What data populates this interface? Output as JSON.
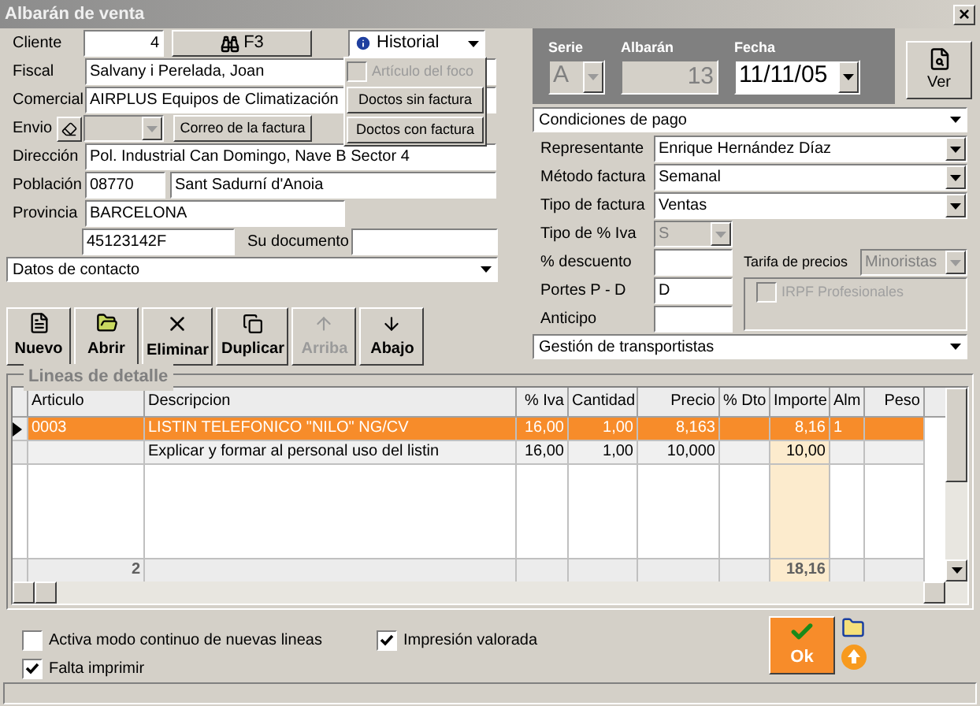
{
  "window": {
    "title": "Albarán de venta",
    "close": "×"
  },
  "cliente": {
    "label": "Cliente",
    "value": "4",
    "search_button": "F3"
  },
  "historial": {
    "label": "Historial",
    "expanded": true,
    "items": [
      {
        "kind": "checkbox",
        "label": "Artículo del foco",
        "disabled": true,
        "checked": false
      },
      {
        "kind": "button",
        "label": "Doctos sin factura"
      },
      {
        "kind": "button",
        "label": "Doctos con factura"
      }
    ]
  },
  "fiscal": {
    "label": "Fiscal",
    "value": "Salvany i Perelada, Joan"
  },
  "comercial": {
    "label": "Comercial",
    "value": "AIRPLUS Equipos de Climatización"
  },
  "envio": {
    "label": "Envio",
    "mail_button": "Correo de la factura"
  },
  "direccion": {
    "label": "Dirección",
    "value": "Pol. Industrial Can Domingo, Nave B Sector 4"
  },
  "poblacion": {
    "label": "Población",
    "postal_code": "08770",
    "town": "Sant Sadurní d'Anoia"
  },
  "provincia": {
    "label": "Provincia",
    "value": "BARCELONA"
  },
  "nif": {
    "value": "45123142F"
  },
  "su_documento": {
    "label": "Su documento"
  },
  "sections": [
    "Datos de contacto",
    "Condiciones de pago",
    "Gestión de transportistas"
  ],
  "header": {
    "serie_label": "Serie",
    "serie": "A",
    "albaran_label": "Albarán",
    "albaran": "13",
    "fecha_label": "Fecha",
    "fecha": "11/11/05",
    "view_button": "Ver"
  },
  "payment": [
    {
      "label": "Representante",
      "value": "Enrique Hernández Díaz"
    },
    {
      "label": "Método factura",
      "value": "Semanal"
    },
    {
      "label": "Tipo de factura",
      "value": "Ventas"
    }
  ],
  "tipo_iva": {
    "label": "Tipo de % Iva",
    "value": "S",
    "disabled": true
  },
  "descuento": {
    "label": "% descuento"
  },
  "portes": {
    "label": "Portes P - D",
    "value": "D"
  },
  "anticipo": {
    "label": "Anticipo"
  },
  "tarifa": {
    "label": "Tarifa de precios",
    "value": "Minoristas",
    "disabled": true
  },
  "irpf": {
    "label": "IRPF Profesionales",
    "checked": false,
    "disabled": true
  },
  "toolbar": [
    {
      "label": "Nuevo",
      "disabled": false
    },
    {
      "label": "Abrir",
      "disabled": false
    },
    {
      "label": "Eliminar",
      "disabled": false
    },
    {
      "label": "Duplicar",
      "disabled": false
    },
    {
      "label": "Arriba",
      "disabled": true
    },
    {
      "label": "Abajo",
      "disabled": false
    }
  ],
  "table": {
    "title": "Lineas de detalle",
    "columns": [
      {
        "label": "Articulo",
        "highlighted": false
      },
      {
        "label": "Descripcion",
        "highlighted": false
      },
      {
        "label": "% Iva",
        "highlighted": false
      },
      {
        "label": "Cantidad",
        "highlighted": false
      },
      {
        "label": "Precio",
        "highlighted": false
      },
      {
        "label": "% Dto",
        "highlighted": false
      },
      {
        "label": "Importe",
        "highlighted": true
      },
      {
        "label": "Alm",
        "highlighted": false
      },
      {
        "label": "Peso",
        "highlighted": false
      }
    ],
    "rows": [
      {
        "selected": true,
        "cells": [
          "0003",
          "LISTIN TELEFONICO \"NILO\" NG/CV",
          "16,00",
          "1,00",
          "8,163",
          "",
          "8,16",
          "1",
          ""
        ]
      },
      {
        "selected": false,
        "cells": [
          "",
          "Explicar y formar al personal uso del listin",
          "16,00",
          "1,00",
          "10,000",
          "",
          "10,00",
          "",
          ""
        ]
      }
    ],
    "totals": {
      "count": "2",
      "importe": "18,16"
    }
  },
  "options": [
    {
      "label": "Activa modo continuo de nuevas lineas",
      "checked": false
    },
    {
      "label": "Impresión valorada",
      "checked": true
    },
    {
      "label": "Falta imprimir",
      "checked": true
    }
  ],
  "ok_button": "Ok"
}
